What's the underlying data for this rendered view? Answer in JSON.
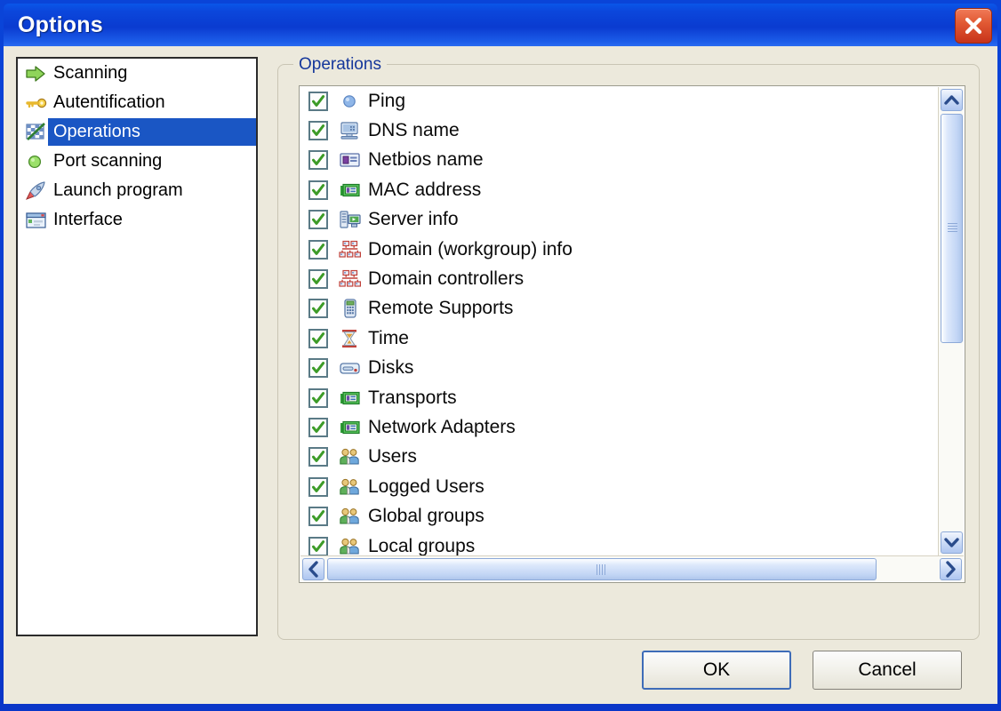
{
  "window": {
    "title": "Options",
    "close_icon": "close-x-icon",
    "titlebar_color": "#0B47DC",
    "client_bg": "#ECE9DC"
  },
  "sidebar": {
    "items": [
      {
        "label": "Scanning",
        "icon": "green-arrow-icon",
        "selected": false
      },
      {
        "label": "Autentification",
        "icon": "yellow-key-icon",
        "selected": false
      },
      {
        "label": "Operations",
        "icon": "checkered-flag-icon",
        "selected": true
      },
      {
        "label": "Port scanning",
        "icon": "green-circle-icon",
        "selected": false
      },
      {
        "label": "Launch program",
        "icon": "rocket-icon",
        "selected": false
      },
      {
        "label": "Interface",
        "icon": "window-icon",
        "selected": false
      }
    ],
    "selection_color": "#1A56C4"
  },
  "group": {
    "label": "Operations",
    "label_color": "#15379B"
  },
  "operations_list": {
    "items": [
      {
        "label": "Ping",
        "icon": "blue-circle-icon",
        "checked": true
      },
      {
        "label": "DNS name",
        "icon": "monitor-icon",
        "checked": true
      },
      {
        "label": "Netbios name",
        "icon": "id-card-icon",
        "checked": true
      },
      {
        "label": "MAC address",
        "icon": "network-card-icon",
        "checked": true
      },
      {
        "label": "Server info",
        "icon": "server-icon",
        "checked": true
      },
      {
        "label": "Domain (workgroup) info",
        "icon": "network-tree-icon",
        "checked": true
      },
      {
        "label": "Domain controllers",
        "icon": "network-tree-icon",
        "checked": true
      },
      {
        "label": "Remote Supports",
        "icon": "remote-control-icon",
        "checked": true
      },
      {
        "label": "Time",
        "icon": "hourglass-icon",
        "checked": true
      },
      {
        "label": "Disks",
        "icon": "disk-drive-icon",
        "checked": true
      },
      {
        "label": "Transports",
        "icon": "network-card-icon",
        "checked": true
      },
      {
        "label": "Network Adapters",
        "icon": "network-card-icon",
        "checked": true
      },
      {
        "label": "Users",
        "icon": "users-group-icon",
        "checked": true
      },
      {
        "label": "Logged Users",
        "icon": "users-group-icon",
        "checked": true
      },
      {
        "label": "Global groups",
        "icon": "users-group-icon",
        "checked": true
      },
      {
        "label": "Local groups",
        "icon": "users-group-icon",
        "checked": true
      }
    ],
    "check_color": "#3C9B27"
  },
  "scrollbars": {
    "vertical": {
      "up_icon": "chevron-up-icon",
      "down_icon": "chevron-down-icon"
    },
    "horizontal": {
      "left_icon": "chevron-left-icon",
      "right_icon": "chevron-right-icon"
    }
  },
  "buttons": {
    "ok": "OK",
    "cancel": "Cancel"
  }
}
